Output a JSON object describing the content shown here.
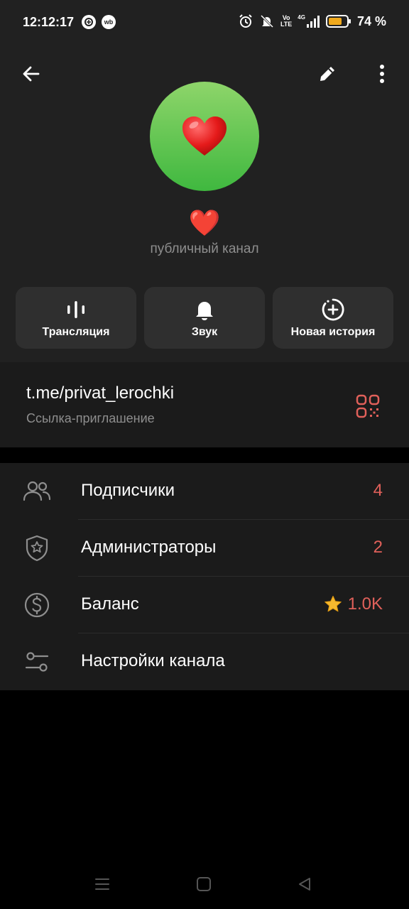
{
  "status_bar": {
    "time": "12:12:17",
    "app_badges": [
      "",
      "wb"
    ],
    "volte_line1": "Vo",
    "volte_line2": "LTE",
    "network": "4G",
    "battery": "74 %"
  },
  "channel": {
    "title": "❤️",
    "subtitle": "публичный канал"
  },
  "actions": [
    {
      "label": "Трансляция",
      "icon": "stream-icon"
    },
    {
      "label": "Звук",
      "icon": "bell-icon"
    },
    {
      "label": "Новая история",
      "icon": "add-story-icon"
    }
  ],
  "link": {
    "url": "t.me/privat_lerochki",
    "caption": "Ссылка-приглашение"
  },
  "menu": [
    {
      "label": "Подписчики",
      "value": "4",
      "icon": "users-icon"
    },
    {
      "label": "Администраторы",
      "value": "2",
      "icon": "shield-star-icon"
    },
    {
      "label": "Баланс",
      "value": "1.0K",
      "icon": "dollar-circle-icon"
    },
    {
      "label": "Настройки канала",
      "value": "",
      "icon": "sliders-icon"
    }
  ],
  "colors": {
    "accent": "#e0605a",
    "header_bg": "#212121",
    "button_bg": "#2f2f2f",
    "avatar_top": "#8ed56a",
    "avatar_bottom": "#3fb83f"
  }
}
